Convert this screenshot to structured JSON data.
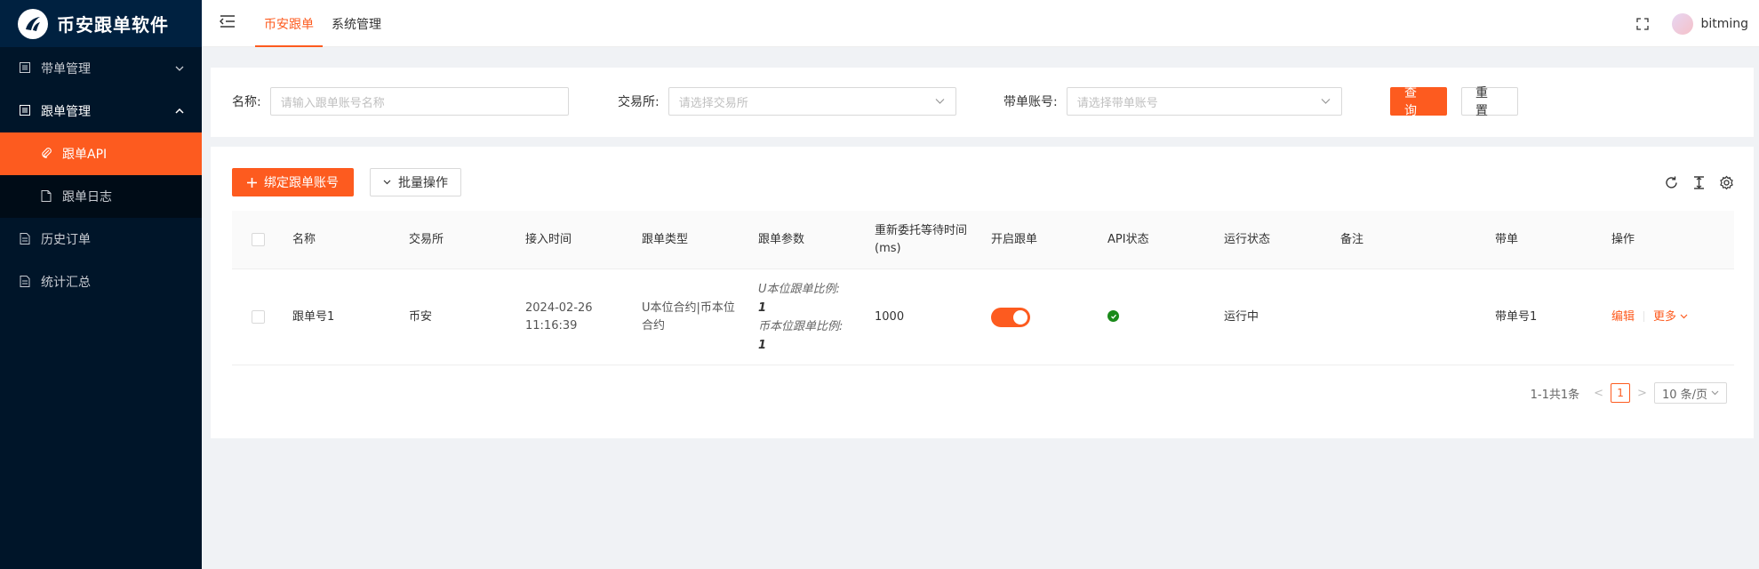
{
  "app": {
    "title": "币安跟单软件"
  },
  "sidebar": {
    "items": [
      {
        "label": "带单管理"
      },
      {
        "label": "跟单管理"
      },
      {
        "label": "跟单API"
      },
      {
        "label": "跟单日志"
      },
      {
        "label": "历史订单"
      },
      {
        "label": "统计汇总"
      }
    ]
  },
  "header": {
    "tabs": [
      {
        "label": "币安跟单"
      },
      {
        "label": "系统管理"
      }
    ],
    "username": "bitming"
  },
  "search": {
    "name_label": "名称:",
    "name_placeholder": "请输入跟单账号名称",
    "exchange_label": "交易所:",
    "exchange_placeholder": "请选择交易所",
    "account_label": "带单账号:",
    "account_placeholder": "请选择带单账号",
    "query_label": "查 询",
    "reset_label": "重 置"
  },
  "toolbar": {
    "bind_label": "绑定跟单账号",
    "batch_label": "批量操作"
  },
  "table": {
    "headers": [
      "名称",
      "交易所",
      "接入时间",
      "跟单类型",
      "跟单参数",
      "重新委托等待时间(ms)",
      "开启跟单",
      "API状态",
      "运行状态",
      "备注",
      "带单",
      "操作"
    ],
    "rows": [
      {
        "name": "跟单号1",
        "exchange": "币安",
        "time_date": "2024-02-26",
        "time_clock": "11:16:39",
        "type": "U本位合约|币本位合约",
        "param_u_label": "U本位跟单比例:",
        "param_u_value": "1",
        "param_c_label": "币本位跟单比例:",
        "param_c_value": "1",
        "wait_ms": "1000",
        "follow_enabled": true,
        "api_status": "ok",
        "run_status": "运行中",
        "remark": "",
        "lead": "带单号1",
        "edit_label": "编辑",
        "more_label": "更多"
      }
    ]
  },
  "pagination": {
    "summary": "1-1共1条",
    "current_page": "1",
    "page_size": "10 条/页"
  },
  "colors": {
    "accent": "#fd5b1f",
    "sidebar_bg": "#001529",
    "ok": "#1a8a1a"
  }
}
